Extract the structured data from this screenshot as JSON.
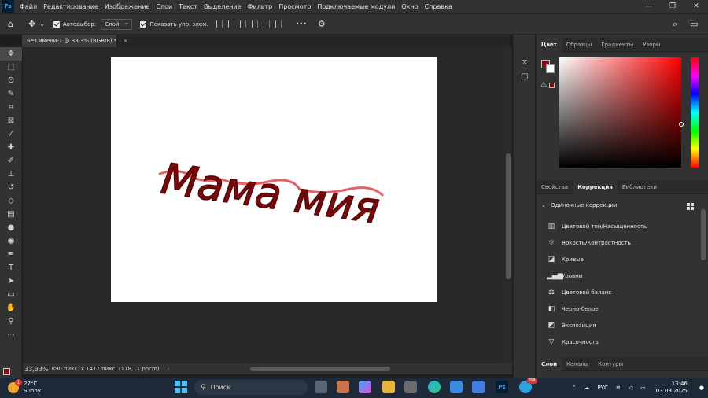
{
  "app": {
    "logo": "Ps"
  },
  "menu": [
    "Файл",
    "Редактирование",
    "Изображение",
    "Слои",
    "Текст",
    "Выделение",
    "Фильтр",
    "Просмотр",
    "Подключаемые модули",
    "Окно",
    "Справка"
  ],
  "window_controls": {
    "minimize": "—",
    "restore": "❐",
    "close": "✕"
  },
  "options_bar": {
    "autoselect_label": "Автовыбор:",
    "autoselect_value": "Слой",
    "show_controls_label": "Показать упр. элем.",
    "more_label": "•••"
  },
  "document": {
    "tab_title": "Без имени-1 @ 33,3% (RGB/8) *",
    "zoom": "33,33%",
    "info": "890 пикс. x 1417 пикс. (118,11 ppcm)",
    "artwork_text": "Мама мия",
    "stroke_color": "#7a0a0a",
    "underline_color": "#e0454a"
  },
  "tools": [
    "move",
    "marquee",
    "lasso",
    "quick-select",
    "crop",
    "frame",
    "eyedropper",
    "healing",
    "brush",
    "stamp",
    "history-brush",
    "eraser",
    "gradient",
    "blur",
    "dodge",
    "pen",
    "type",
    "path-select",
    "shape",
    "hand",
    "zoom",
    "more"
  ],
  "colors": {
    "foreground": "#8b0a0a",
    "background": "#ffffff"
  },
  "color_panel": {
    "tabs": [
      "Цвет",
      "Образцы",
      "Градиенты",
      "Узоры"
    ],
    "active": 0
  },
  "adjust_panel": {
    "tabs": [
      "Свойства",
      "Коррекция",
      "Библиотеки"
    ],
    "active": 1,
    "section": "Одиночные коррекции",
    "items": [
      {
        "label": "Цветовой тон/Насыщенность",
        "icon": "hue-sat-icon"
      },
      {
        "label": "Яркость/Контрастность",
        "icon": "brightness-icon"
      },
      {
        "label": "Кривые",
        "icon": "curves-icon"
      },
      {
        "label": "Уровни",
        "icon": "levels-icon"
      },
      {
        "label": "Цветовой баланс",
        "icon": "color-balance-icon"
      },
      {
        "label": "Черно-белое",
        "icon": "bw-icon"
      },
      {
        "label": "Экспозиция",
        "icon": "exposure-icon"
      },
      {
        "label": "Красочность",
        "icon": "vibrance-icon"
      }
    ]
  },
  "layers_panel": {
    "tabs": [
      "Слои",
      "Каналы",
      "Контуры"
    ],
    "active": 0
  },
  "taskbar": {
    "weather_temp": "27°C",
    "weather_desc": "Sunny",
    "weather_badge": "1",
    "search_placeholder": "Поиск",
    "telegram_badge": "268",
    "lang": "РУС",
    "time": "13:46",
    "date": "03.09.2025"
  }
}
